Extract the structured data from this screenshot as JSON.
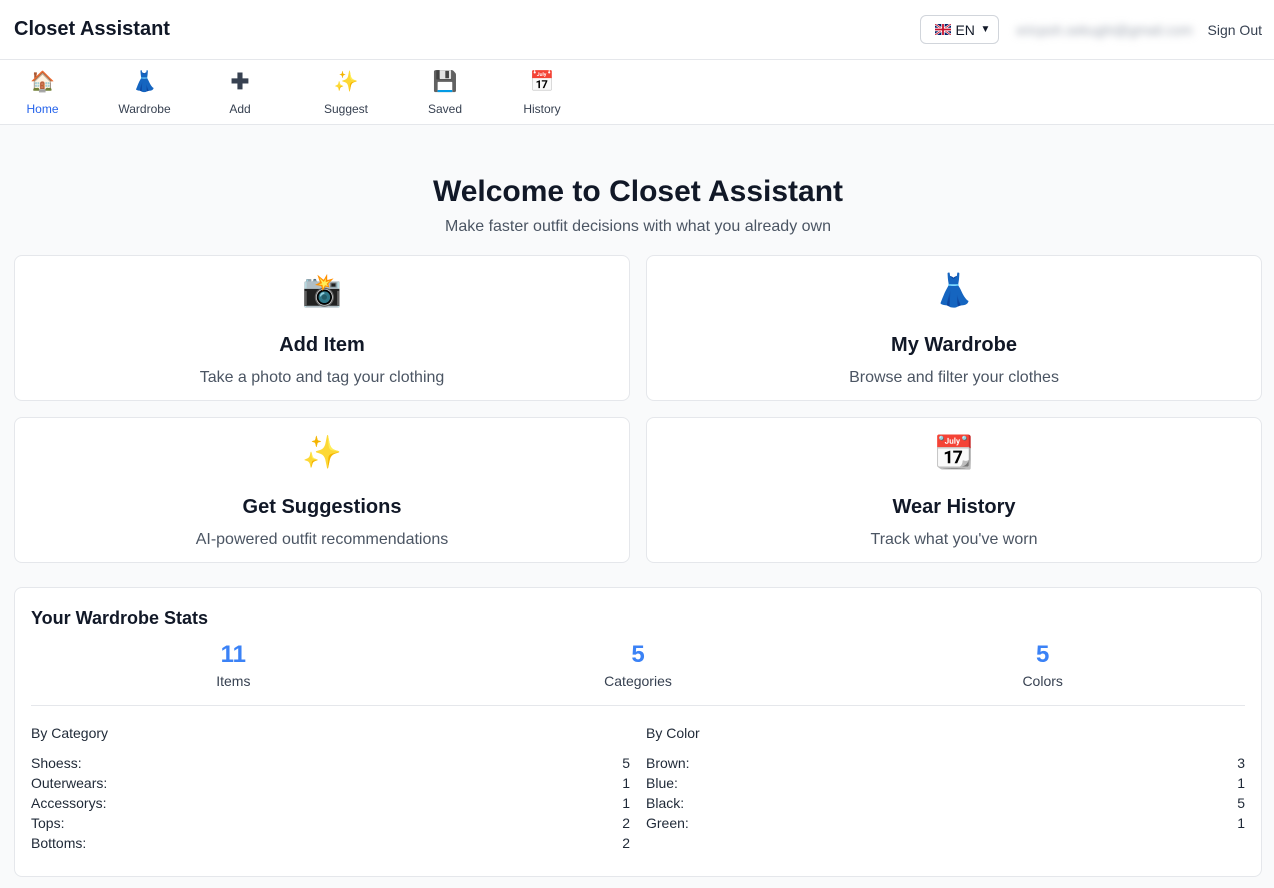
{
  "header": {
    "app_title": "Closet Assistant",
    "language": "EN",
    "email": "ericpoh.sekughi@gmail.com",
    "signout": "Sign Out"
  },
  "nav": [
    {
      "icon": "house-icon",
      "glyph": "🏠",
      "label": "Home",
      "active": true
    },
    {
      "icon": "dress-icon",
      "glyph": "👗",
      "label": "Wardrobe",
      "active": false
    },
    {
      "icon": "plus-icon",
      "glyph": "➕",
      "label": "Add",
      "active": false
    },
    {
      "icon": "sparkles-icon",
      "glyph": "✨",
      "label": "Suggest",
      "active": false
    },
    {
      "icon": "floppy-disk-icon",
      "glyph": "💾",
      "label": "Saved",
      "active": false
    },
    {
      "icon": "calendar-icon",
      "glyph": "📅",
      "label": "History",
      "active": false
    }
  ],
  "hero": {
    "title": "Welcome to Closet Assistant",
    "subtitle": "Make faster outfit decisions with what you already own"
  },
  "cards": [
    {
      "icon": "camera-flash-icon",
      "glyph": "📸",
      "title": "Add Item",
      "desc": "Take a photo and tag your clothing"
    },
    {
      "icon": "dress-icon",
      "glyph": "👗",
      "title": "My Wardrobe",
      "desc": "Browse and filter your clothes"
    },
    {
      "icon": "sparkles-icon",
      "glyph": "✨",
      "title": "Get Suggestions",
      "desc": "AI-powered outfit recommendations"
    },
    {
      "icon": "calendar-icon",
      "glyph": "📆",
      "title": "Wear History",
      "desc": "Track what you've worn"
    }
  ],
  "stats": {
    "title": "Your Wardrobe Stats",
    "summary": [
      {
        "value": "11",
        "label": "Items"
      },
      {
        "value": "5",
        "label": "Categories"
      },
      {
        "value": "5",
        "label": "Colors"
      }
    ],
    "by_category": {
      "title": "By Category",
      "rows": [
        {
          "name": "Shoess:",
          "count": "5"
        },
        {
          "name": "Outerwears:",
          "count": "1"
        },
        {
          "name": "Accessorys:",
          "count": "1"
        },
        {
          "name": "Tops:",
          "count": "2"
        },
        {
          "name": "Bottoms:",
          "count": "2"
        }
      ]
    },
    "by_color": {
      "title": "By Color",
      "rows": [
        {
          "name": "Brown:",
          "count": "3"
        },
        {
          "name": "Blue:",
          "count": "1"
        },
        {
          "name": "Black:",
          "count": "5"
        },
        {
          "name": "Green:",
          "count": "1"
        }
      ]
    }
  },
  "colors": {
    "accent": "#2563eb",
    "stat_value": "#3b82f6"
  }
}
